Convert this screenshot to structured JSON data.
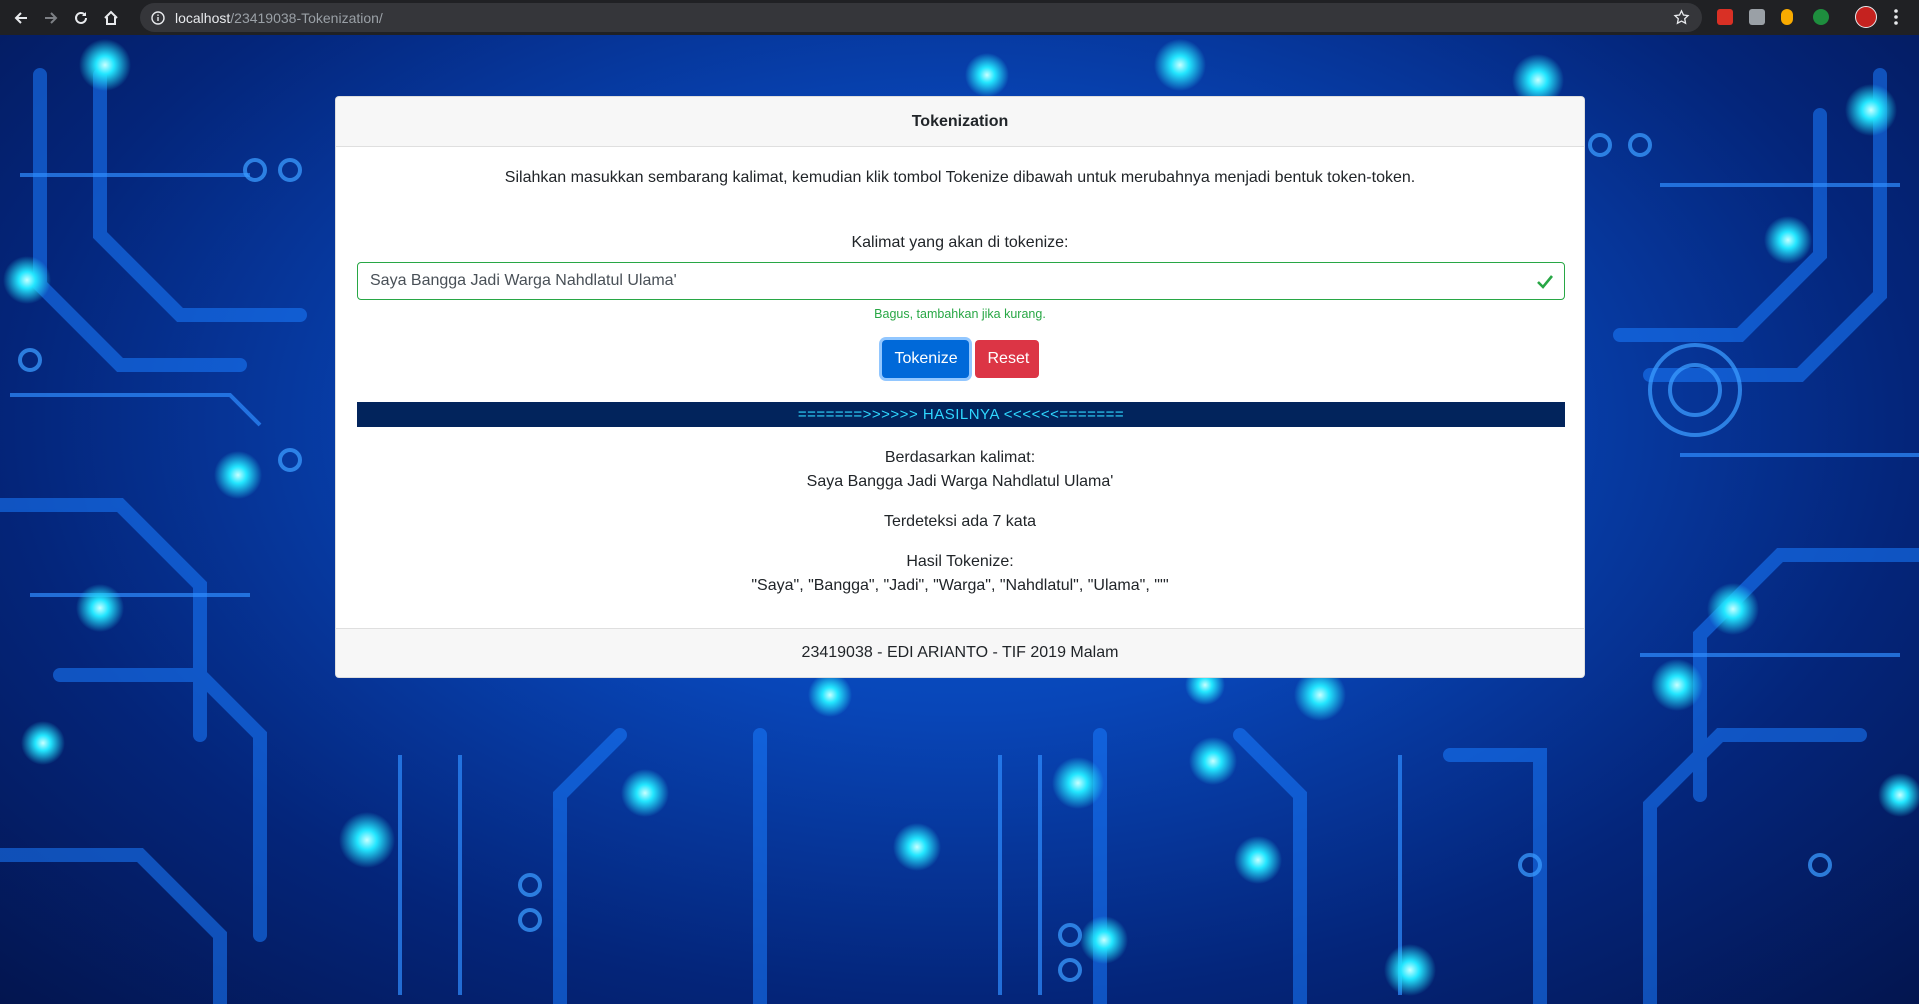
{
  "browser": {
    "url_host": "localhost",
    "url_path": "/23419038-Tokenization/"
  },
  "card": {
    "title": "Tokenization",
    "intro": "Silahkan masukkan sembarang kalimat, kemudian klik tombol Tokenize dibawah untuk merubahnya menjadi bentuk token-token.",
    "field_label": "Kalimat yang akan di tokenize:",
    "input_value": "Saya Bangga Jadi Warga Nahdlatul Ulama'",
    "feedback": "Bagus, tambahkan jika kurang.",
    "tokenize_button": "Tokenize",
    "reset_button": "Reset",
    "result_header": "=======>>>>>> HASILNYA <<<<<<=======",
    "based_on_label": "Berdasarkan kalimat:",
    "based_on_sentence": "Saya Bangga Jadi Warga Nahdlatul Ulama'",
    "word_count_text": "Terdeteksi ada 7 kata",
    "tokens_label": "Hasil Tokenize:",
    "tokens_text": "\"Saya\", \"Bangga\", \"Jadi\", \"Warga\", \"Nahdlatul\", \"Ulama\", \"'\"",
    "footer": "23419038 - EDI ARIANTO - TIF 2019 Malam"
  },
  "colors": {
    "valid": "#28a745",
    "primary": "#0069d9",
    "danger": "#dc3545",
    "result_bar": "#02245c",
    "result_text": "#2fd7ff"
  }
}
